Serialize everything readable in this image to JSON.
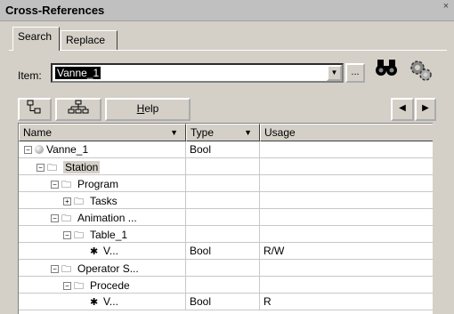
{
  "window": {
    "title": "Cross-References",
    "close_glyph": "×"
  },
  "tabs": [
    {
      "label": "Search",
      "active": true
    },
    {
      "label": "Replace",
      "active": false
    }
  ],
  "item_field": {
    "label": "Item:",
    "value": "Vanne_1"
  },
  "buttons": {
    "browse": "...",
    "find_icon": "binoculars-icon",
    "settings_icon": "gear-icon",
    "help_label_underlined": "H",
    "help_label_rest": "elp",
    "nav_left": "◀",
    "nav_right": "▶"
  },
  "columns": [
    {
      "label": "Name",
      "sort_arrow": "▼"
    },
    {
      "label": "Type",
      "sort_arrow": "▼"
    },
    {
      "label": "Usage",
      "sort_arrow": ""
    }
  ],
  "rows": [
    {
      "name": "Vanne_1",
      "type": "Bool",
      "usage": "",
      "expander": "−",
      "icon": "ball"
    },
    {
      "name": "Station",
      "type": "",
      "usage": "",
      "expander": "−",
      "icon": "folder",
      "selected": true
    },
    {
      "name": "Program",
      "type": "",
      "usage": "",
      "expander": "−",
      "icon": "folder"
    },
    {
      "name": "Tasks",
      "type": "",
      "usage": "",
      "expander": "+",
      "icon": "folder"
    },
    {
      "name": "Animation ...",
      "type": "",
      "usage": "",
      "expander": "−",
      "icon": "folder"
    },
    {
      "name": "Table_1",
      "type": "",
      "usage": "",
      "expander": "−",
      "icon": "folder"
    },
    {
      "name": "V...",
      "type": "Bool",
      "usage": "R/W",
      "expander": "",
      "icon": "leaf"
    },
    {
      "name": "Operator S...",
      "type": "",
      "usage": "",
      "expander": "−",
      "icon": "folder"
    },
    {
      "name": "Procede",
      "type": "",
      "usage": "",
      "expander": "−",
      "icon": "folder"
    },
    {
      "name": "V...",
      "type": "Bool",
      "usage": "R",
      "expander": "",
      "icon": "leaf"
    }
  ]
}
